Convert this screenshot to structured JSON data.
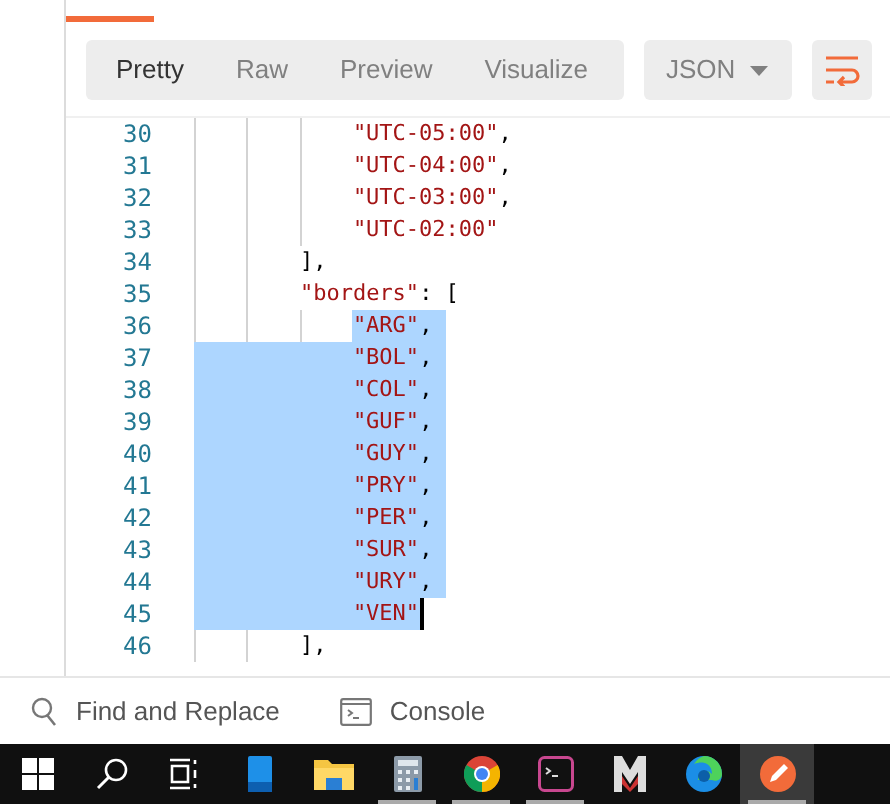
{
  "response_tab": {
    "selected": true
  },
  "toolbar": {
    "view_tabs": [
      {
        "label": "Pretty",
        "selected": true
      },
      {
        "label": "Raw",
        "selected": false
      },
      {
        "label": "Preview",
        "selected": false
      },
      {
        "label": "Visualize",
        "selected": false
      }
    ],
    "format_dropdown": {
      "value": "JSON"
    },
    "wrap_button": {
      "on": true
    }
  },
  "code_lines": [
    {
      "number": "30",
      "kind": "array_item",
      "selected": false,
      "cursor": false,
      "segments": [
        {
          "kind": "string",
          "text": "\"UTC-05:00\""
        },
        {
          "kind": "punct",
          "text": ","
        }
      ]
    },
    {
      "number": "31",
      "kind": "array_item",
      "selected": false,
      "cursor": false,
      "segments": [
        {
          "kind": "string",
          "text": "\"UTC-04:00\""
        },
        {
          "kind": "punct",
          "text": ","
        }
      ]
    },
    {
      "number": "32",
      "kind": "array_item",
      "selected": false,
      "cursor": false,
      "segments": [
        {
          "kind": "string",
          "text": "\"UTC-03:00\""
        },
        {
          "kind": "punct",
          "text": ","
        }
      ]
    },
    {
      "number": "33",
      "kind": "array_item",
      "selected": false,
      "cursor": false,
      "segments": [
        {
          "kind": "string",
          "text": "\"UTC-02:00\""
        }
      ]
    },
    {
      "number": "34",
      "kind": "property",
      "selected": false,
      "cursor": false,
      "segments": [
        {
          "kind": "punct",
          "text": "],"
        }
      ]
    },
    {
      "number": "35",
      "kind": "property",
      "selected": false,
      "cursor": false,
      "segments": [
        {
          "kind": "string",
          "text": "\"borders\""
        },
        {
          "kind": "punct",
          "text": ": ["
        }
      ]
    },
    {
      "number": "36",
      "kind": "array_item",
      "selected": true,
      "selection_start": true,
      "cursor": false,
      "segments": [
        {
          "kind": "string",
          "text": "\"ARG\""
        },
        {
          "kind": "punct",
          "text": ","
        }
      ]
    },
    {
      "number": "37",
      "kind": "array_item",
      "selected": true,
      "selection_start": false,
      "cursor": false,
      "segments": [
        {
          "kind": "string",
          "text": "\"BOL\""
        },
        {
          "kind": "punct",
          "text": ","
        }
      ]
    },
    {
      "number": "38",
      "kind": "array_item",
      "selected": true,
      "selection_start": false,
      "cursor": false,
      "segments": [
        {
          "kind": "string",
          "text": "\"COL\""
        },
        {
          "kind": "punct",
          "text": ","
        }
      ]
    },
    {
      "number": "39",
      "kind": "array_item",
      "selected": true,
      "selection_start": false,
      "cursor": false,
      "segments": [
        {
          "kind": "string",
          "text": "\"GUF\""
        },
        {
          "kind": "punct",
          "text": ","
        }
      ]
    },
    {
      "number": "40",
      "kind": "array_item",
      "selected": true,
      "selection_start": false,
      "cursor": false,
      "segments": [
        {
          "kind": "string",
          "text": "\"GUY\""
        },
        {
          "kind": "punct",
          "text": ","
        }
      ]
    },
    {
      "number": "41",
      "kind": "array_item",
      "selected": true,
      "selection_start": false,
      "cursor": false,
      "segments": [
        {
          "kind": "string",
          "text": "\"PRY\""
        },
        {
          "kind": "punct",
          "text": ","
        }
      ]
    },
    {
      "number": "42",
      "kind": "array_item",
      "selected": true,
      "selection_start": false,
      "cursor": false,
      "segments": [
        {
          "kind": "string",
          "text": "\"PER\""
        },
        {
          "kind": "punct",
          "text": ","
        }
      ]
    },
    {
      "number": "43",
      "kind": "array_item",
      "selected": true,
      "selection_start": false,
      "cursor": false,
      "segments": [
        {
          "kind": "string",
          "text": "\"SUR\""
        },
        {
          "kind": "punct",
          "text": ","
        }
      ]
    },
    {
      "number": "44",
      "kind": "array_item",
      "selected": true,
      "selection_start": false,
      "cursor": false,
      "segments": [
        {
          "kind": "string",
          "text": "\"URY\""
        },
        {
          "kind": "punct",
          "text": ","
        }
      ]
    },
    {
      "number": "45",
      "kind": "array_item",
      "selected": true,
      "selection_start": false,
      "cursor": true,
      "segments": [
        {
          "kind": "string",
          "text": "\"VEN\""
        }
      ]
    },
    {
      "number": "46",
      "kind": "property",
      "selected": false,
      "cursor": false,
      "segments": [
        {
          "kind": "punct",
          "text": "],"
        }
      ]
    }
  ],
  "footer": [
    {
      "kind": "find",
      "label": "Find and Replace"
    },
    {
      "kind": "console",
      "label": "Console"
    }
  ],
  "taskbar": [
    {
      "kind": "start",
      "running": false,
      "active": false
    },
    {
      "kind": "search",
      "running": false,
      "active": false
    },
    {
      "kind": "taskview",
      "running": false,
      "active": false
    },
    {
      "kind": "phone",
      "running": false,
      "active": false
    },
    {
      "kind": "folder",
      "running": false,
      "active": false
    },
    {
      "kind": "calculator",
      "running": true,
      "active": false
    },
    {
      "kind": "browser",
      "running": true,
      "active": false
    },
    {
      "kind": "terminal",
      "running": true,
      "active": false
    },
    {
      "kind": "mletter",
      "running": false,
      "active": false
    },
    {
      "kind": "edge",
      "running": false,
      "active": false
    },
    {
      "kind": "postman",
      "running": true,
      "active": true
    }
  ]
}
